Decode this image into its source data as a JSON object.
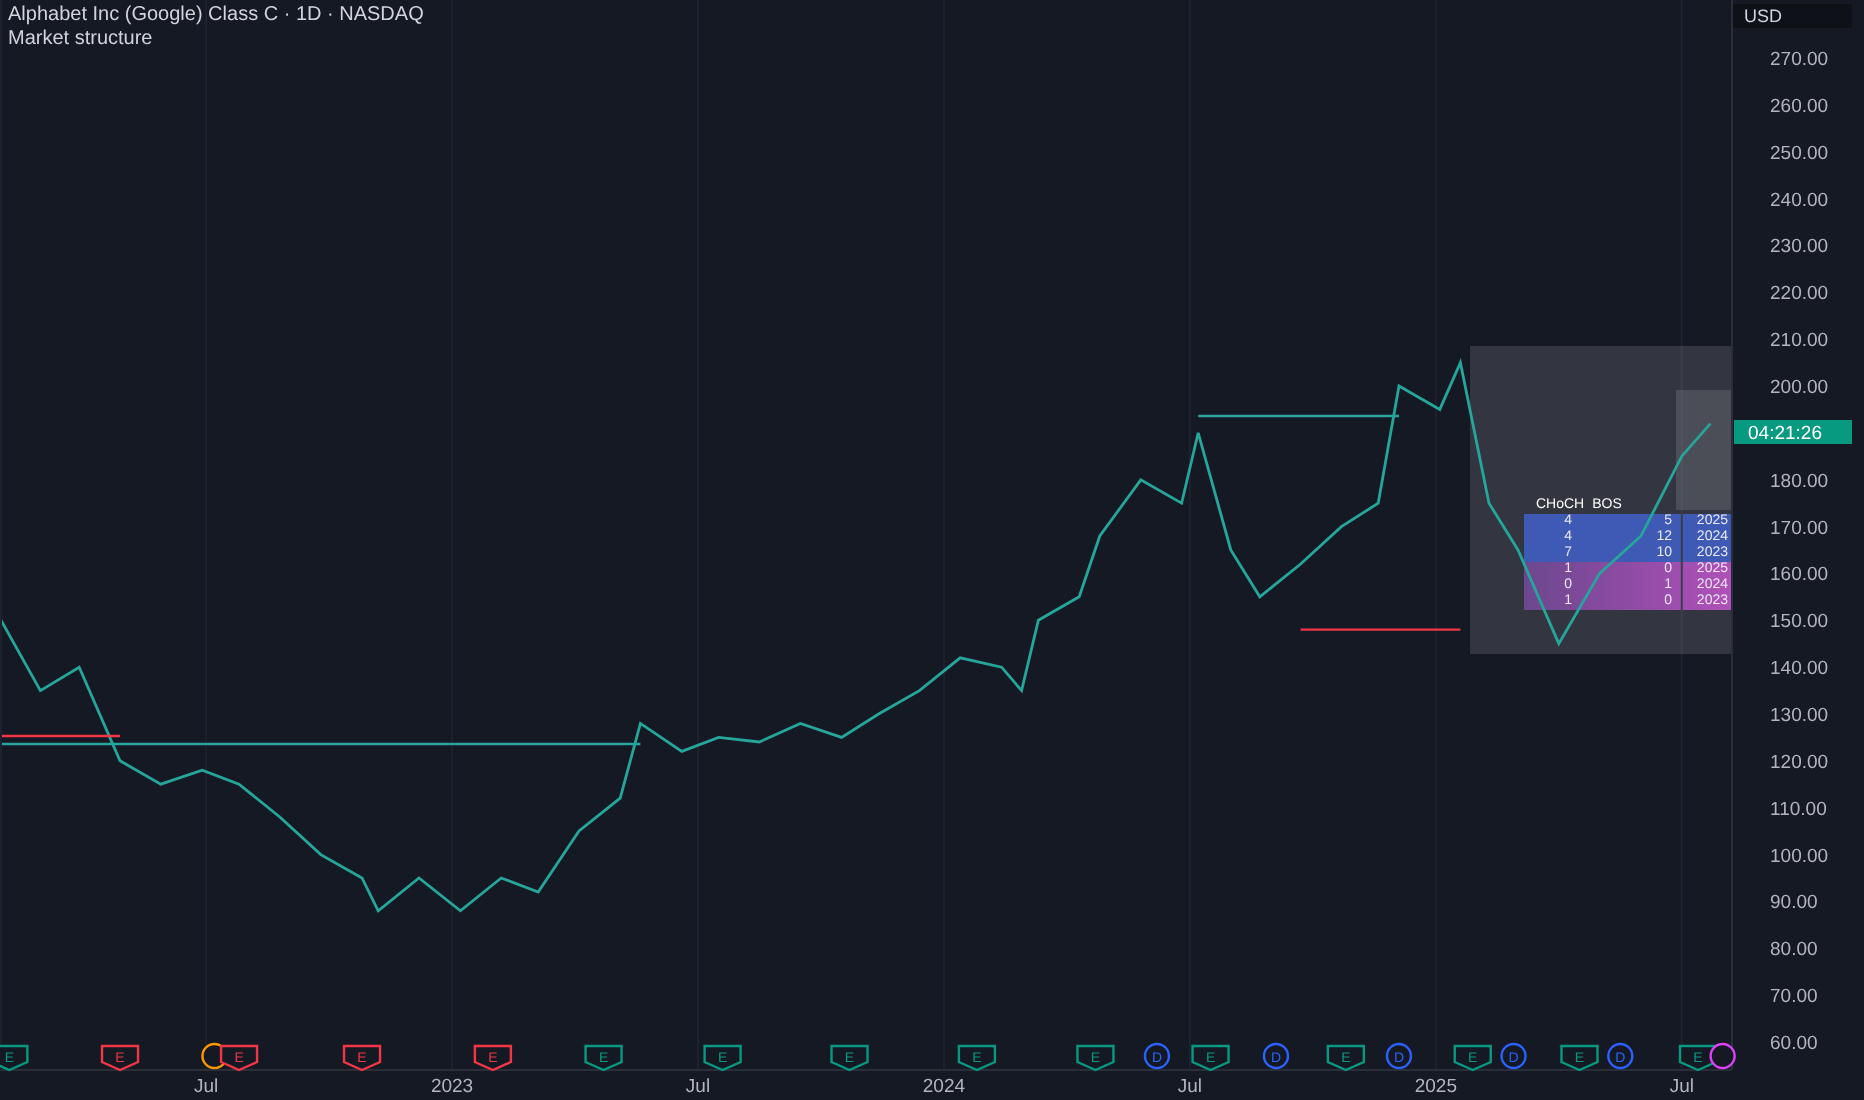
{
  "header": {
    "title": "Alphabet Inc (Google) Class C · 1D · NASDAQ",
    "indicator": "Market structure",
    "currency": "USD"
  },
  "chart": {
    "chart_data": {
      "type": "line",
      "x": [
        2022.083,
        2022.163,
        2022.242,
        2022.325,
        2022.408,
        2022.492,
        2022.567,
        2022.65,
        2022.733,
        2022.817,
        2022.85,
        2022.933,
        2023.017,
        2023.1,
        2023.175,
        2023.258,
        2023.342,
        2023.383,
        2023.467,
        2023.542,
        2023.625,
        2023.708,
        2023.792,
        2023.867,
        2023.95,
        2024.033,
        2024.117,
        2024.158,
        2024.192,
        2024.275,
        2024.317,
        2024.4,
        2024.483,
        2024.517,
        2024.583,
        2024.642,
        2024.725,
        2024.808,
        2024.883,
        2024.925,
        2025.008,
        2025.05,
        2025.108,
        2025.167,
        2025.25,
        2025.333,
        2025.417,
        2025.5,
        2025.558
      ],
      "series": [
        {
          "color": "#26a69a",
          "values": [
            150,
            135,
            140,
            120,
            115,
            118,
            115,
            108,
            100,
            95,
            88,
            95,
            88,
            95,
            92,
            105,
            112,
            128,
            122,
            125,
            124,
            128,
            125,
            130,
            135,
            142,
            140,
            135,
            150,
            155,
            168,
            180,
            175,
            190,
            165,
            155,
            162,
            170,
            175,
            200,
            195,
            205,
            175,
            165,
            145,
            160,
            168,
            185,
            192
          ]
        },
        {
          "color": "#26a69a",
          "values": [
            123.6,
            123.6,
            123.6,
            123.6,
            123.6,
            123.6,
            123.6,
            123.6,
            123.6,
            123.6,
            123.6,
            123.6,
            123.6,
            123.6,
            123.6,
            123.6,
            123.6,
            123.6,
            null,
            null,
            null,
            null,
            null,
            null,
            null,
            null,
            null,
            null,
            null,
            null,
            null,
            null,
            null,
            null,
            null,
            null,
            null,
            null,
            null,
            null,
            null,
            null,
            null,
            null,
            null,
            null,
            null,
            null,
            null
          ]
        },
        {
          "color": "#f23645",
          "values": [
            125.3,
            125.3,
            125.3,
            125.3,
            null,
            null,
            null,
            null,
            null,
            null,
            null,
            null,
            null,
            null,
            null,
            null,
            null,
            null,
            null,
            null,
            null,
            null,
            null,
            null,
            null,
            null,
            null,
            null,
            null,
            null,
            null,
            null,
            null,
            null,
            null,
            null,
            null,
            null,
            null,
            null,
            null,
            null,
            null,
            null,
            null,
            null,
            null,
            null,
            null
          ]
        },
        {
          "color": "#26a69a",
          "values": [
            null,
            null,
            null,
            null,
            null,
            null,
            null,
            null,
            null,
            null,
            null,
            null,
            null,
            null,
            null,
            null,
            null,
            null,
            null,
            null,
            null,
            null,
            null,
            null,
            null,
            null,
            null,
            null,
            null,
            null,
            null,
            null,
            null,
            193.6,
            193.6,
            193.6,
            193.6,
            193.6,
            193.6,
            193.6,
            null,
            null,
            null,
            null,
            null,
            null,
            null,
            null,
            null
          ]
        },
        {
          "color": "#f23645",
          "values": [
            null,
            null,
            null,
            null,
            null,
            null,
            null,
            null,
            null,
            null,
            null,
            null,
            null,
            null,
            null,
            null,
            null,
            null,
            null,
            null,
            null,
            null,
            null,
            null,
            null,
            null,
            null,
            null,
            null,
            null,
            null,
            null,
            null,
            null,
            null,
            null,
            148.0,
            148.0,
            148.0,
            148.0,
            148.0,
            148.0,
            null,
            null,
            null,
            null,
            null,
            null,
            null
          ]
        }
      ],
      "xlim": [
        2022.081,
        2025.598
      ],
      "ylim": [
        54,
        282.4
      ],
      "grid": true,
      "xticks": [
        {
          "value": 2022.5,
          "label": "Jul"
        },
        {
          "value": 2023,
          "label": "2023"
        },
        {
          "value": 2023.5,
          "label": "Jul"
        },
        {
          "value": 2024,
          "label": "2024"
        },
        {
          "value": 2024.5,
          "label": "Jul"
        },
        {
          "value": 2025,
          "label": "2025"
        },
        {
          "value": 2025.5,
          "label": "Jul"
        }
      ],
      "yticks": [
        {
          "value": 270,
          "label": "270.00"
        },
        {
          "value": 260,
          "label": "260.00"
        },
        {
          "value": 250,
          "label": "250.00"
        },
        {
          "value": 240,
          "label": "240.00"
        },
        {
          "value": 230,
          "label": "230.00"
        },
        {
          "value": 220,
          "label": "220.00"
        },
        {
          "value": 210,
          "label": "210.00"
        },
        {
          "value": 200,
          "label": "200.00"
        },
        {
          "value": 180,
          "label": "180.00"
        },
        {
          "value": 170,
          "label": "170.00"
        },
        {
          "value": 160,
          "label": "160.00"
        },
        {
          "value": 150,
          "label": "150.00"
        },
        {
          "value": 140,
          "label": "140.00"
        },
        {
          "value": 130,
          "label": "130.00"
        },
        {
          "value": 120,
          "label": "120.00"
        },
        {
          "value": 110,
          "label": "110.00"
        },
        {
          "value": 100,
          "label": "100.00"
        },
        {
          "value": 90,
          "label": "90.00"
        },
        {
          "value": 80,
          "label": "80.00"
        },
        {
          "value": 70,
          "label": "70.00"
        },
        {
          "value": 60,
          "label": "60.00"
        }
      ]
    },
    "countdown": "04:21:26",
    "events": [
      {
        "kind": "earnings",
        "label": "E",
        "color": "#089981"
      },
      {
        "kind": "earnings",
        "label": "E",
        "color": "#f23645"
      },
      {
        "kind": "ring",
        "color": "#ff9800"
      },
      {
        "kind": "earnings",
        "label": "E",
        "color": "#f23645"
      },
      {
        "kind": "earnings",
        "label": "E",
        "color": "#f23645"
      },
      {
        "kind": "earnings",
        "label": "E",
        "color": "#f23645"
      },
      {
        "kind": "earnings",
        "label": "E",
        "color": "#089981"
      },
      {
        "kind": "earnings",
        "label": "E",
        "color": "#089981"
      },
      {
        "kind": "earnings",
        "label": "E",
        "color": "#089981"
      },
      {
        "kind": "earnings",
        "label": "E",
        "color": "#089981"
      },
      {
        "kind": "earnings",
        "label": "E",
        "color": "#089981"
      },
      {
        "kind": "dividend",
        "label": "D",
        "color": "#2962ff"
      },
      {
        "kind": "earnings",
        "label": "E",
        "color": "#089981"
      },
      {
        "kind": "dividend",
        "label": "D",
        "color": "#2962ff"
      },
      {
        "kind": "earnings",
        "label": "E",
        "color": "#089981"
      },
      {
        "kind": "dividend",
        "label": "D",
        "color": "#2962ff"
      },
      {
        "kind": "earnings",
        "label": "E",
        "color": "#089981"
      },
      {
        "kind": "dividend",
        "label": "D",
        "color": "#2962ff"
      },
      {
        "kind": "earnings",
        "label": "E",
        "color": "#089981"
      },
      {
        "kind": "dividend",
        "label": "D",
        "color": "#2962ff"
      },
      {
        "kind": "earnings",
        "label": "E",
        "color": "#089981"
      },
      {
        "kind": "ring",
        "color": "#e040fb"
      }
    ]
  },
  "stats_table": {
    "columns": [
      "CHoCH",
      "BOS"
    ],
    "rows": [
      {
        "kind": "bullish",
        "cells": [
          "4",
          "5",
          "2025"
        ]
      },
      {
        "kind": "bullish",
        "cells": [
          "4",
          "12",
          "2024"
        ]
      },
      {
        "kind": "bullish",
        "cells": [
          "7",
          "10",
          "2023"
        ]
      },
      {
        "kind": "bearish",
        "cells": [
          "1",
          "0",
          "2025"
        ]
      },
      {
        "kind": "bearish",
        "cells": [
          "0",
          "1",
          "2024"
        ]
      },
      {
        "kind": "bearish",
        "cells": [
          "1",
          "0",
          "2023"
        ]
      }
    ]
  }
}
